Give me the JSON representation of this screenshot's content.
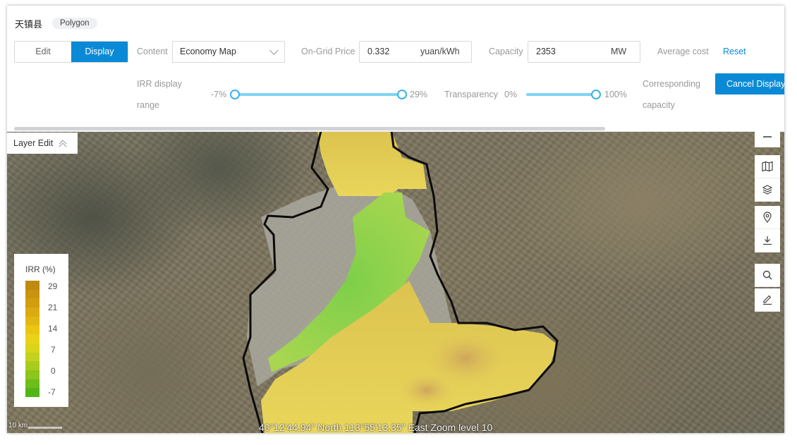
{
  "header": {
    "county": "天镇县",
    "geometry_tag": "Polygon"
  },
  "mode": {
    "edit_label": "Edit",
    "display_label": "Display",
    "active": "Display"
  },
  "content": {
    "label": "Content",
    "value": "Economy Map"
  },
  "price": {
    "label": "On-Grid Price",
    "value": "0.332",
    "unit": "yuan/kWh"
  },
  "capacity": {
    "label": "Capacity",
    "value": "2353",
    "unit": "MW"
  },
  "avg_cost": {
    "label": "Average cost",
    "reset_label": "Reset"
  },
  "irr_range": {
    "label_line1": "IRR display",
    "label_line2": "range",
    "min_label": "-7%",
    "max_label": "29%"
  },
  "transparency": {
    "label": "Transparency",
    "min_label": "0%",
    "max_label": "100%"
  },
  "corresponding": {
    "label_line1": "Corresponding",
    "label_line2": "capacity",
    "button": "Cancel Display"
  },
  "layer_edit": {
    "label": "Layer Edit"
  },
  "legend": {
    "title": "IRR (%)",
    "ticks": [
      "29",
      "21",
      "14",
      "7",
      "0",
      "-7"
    ],
    "colors": [
      "#c08a10",
      "#c9930f",
      "#d19e0f",
      "#dbaa10",
      "#e1b712",
      "#e8c613",
      "#ead317",
      "#d8d51a",
      "#c3d21c",
      "#a8cc1e",
      "#8cc51c",
      "#6ebd19",
      "#53b516"
    ]
  },
  "status": {
    "coords": "40°12'44.94\" North 113°55'13.35\" East Zoom level 10",
    "scale": "10 km"
  },
  "tools": [
    "minus-icon",
    "map-icon",
    "layers-icon",
    "location-icon",
    "download-icon",
    "search-icon",
    "edit-icon"
  ]
}
